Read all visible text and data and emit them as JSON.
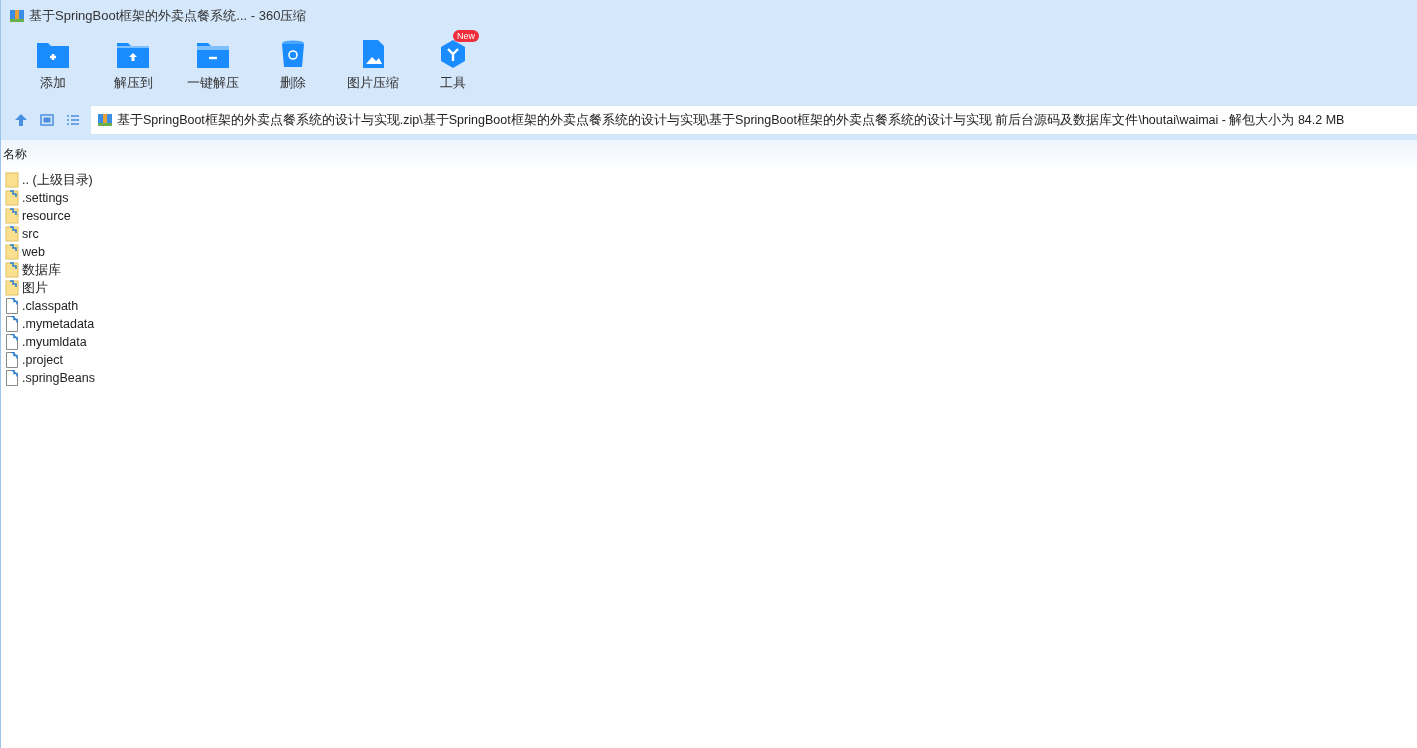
{
  "window": {
    "title": "基于SpringBoot框架的外卖点餐系统... - 360压缩"
  },
  "toolbar": [
    {
      "label": "添加",
      "kind": "add"
    },
    {
      "label": "解压到",
      "kind": "extract"
    },
    {
      "label": "一键解压",
      "kind": "quick"
    },
    {
      "label": "删除",
      "kind": "delete"
    },
    {
      "label": "图片压缩",
      "kind": "image"
    },
    {
      "label": "工具",
      "kind": "tools",
      "badge": "New"
    }
  ],
  "address": {
    "path": "基于SpringBoot框架的外卖点餐系统的设计与实现.zip\\基于SpringBoot框架的外卖点餐系统的设计与实现\\基于SpringBoot框架的外卖点餐系统的设计与实现 前后台源码及数据库文件\\houtai\\waimai - 解包大小为 84.2 MB"
  },
  "table": {
    "columns": [
      "名称"
    ],
    "rows": [
      {
        "name": ".. (上级目录)",
        "kind": "parent"
      },
      {
        "name": ".settings",
        "kind": "folder"
      },
      {
        "name": "resource",
        "kind": "folder"
      },
      {
        "name": "src",
        "kind": "folder"
      },
      {
        "name": "web",
        "kind": "folder"
      },
      {
        "name": "数据库",
        "kind": "folder"
      },
      {
        "name": "图片",
        "kind": "folder"
      },
      {
        "name": ".classpath",
        "kind": "file"
      },
      {
        "name": ".mymetadata",
        "kind": "file"
      },
      {
        "name": ".myumldata",
        "kind": "file"
      },
      {
        "name": ".project",
        "kind": "file"
      },
      {
        "name": ".springBeans",
        "kind": "file"
      }
    ]
  }
}
